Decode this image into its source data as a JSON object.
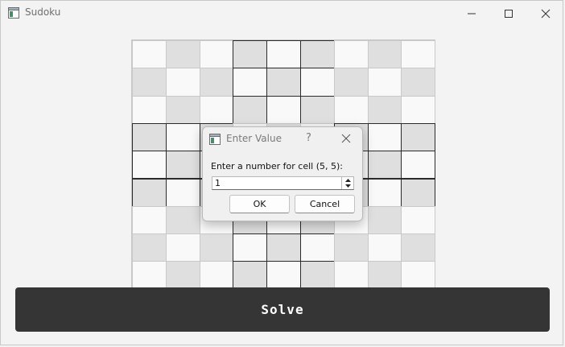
{
  "window": {
    "title": "Sudoku",
    "icon": "app-window-icon",
    "controls": [
      "minimize-icon",
      "maximize-icon",
      "close-icon"
    ]
  },
  "colors": {
    "window_bg": "#f3f3f3",
    "cell_light": "#f9f9f9",
    "cell_dark": "#dfdfdf",
    "cell_border": "#c9c9c9",
    "box_border": "#2b2b2b",
    "solve_bg": "#353535",
    "solve_text": "#ffffff"
  },
  "board": {
    "rows": 9,
    "cols": 9,
    "visible_rows": 9,
    "values": [
      [
        "",
        "",
        "",
        "",
        "",
        "",
        "",
        "",
        ""
      ],
      [
        "",
        "",
        "",
        "",
        "",
        "",
        "",
        "",
        ""
      ],
      [
        "",
        "",
        "",
        "",
        "",
        "",
        "",
        "",
        ""
      ],
      [
        "",
        "",
        "",
        "",
        "",
        "",
        "",
        "",
        ""
      ],
      [
        "",
        "",
        "",
        "",
        "",
        "",
        "",
        "",
        ""
      ],
      [
        "",
        "",
        "",
        "",
        "",
        "",
        "",
        "",
        ""
      ],
      [
        "",
        "",
        "",
        "",
        "",
        "",
        "",
        "",
        ""
      ],
      [
        "",
        "",
        "",
        "",
        "",
        "",
        "",
        "",
        ""
      ],
      [
        "",
        "",
        "",
        "",
        "",
        "",
        "",
        "",
        ""
      ]
    ]
  },
  "solve_button": {
    "label": "Solve"
  },
  "dialog": {
    "title": "Enter Value",
    "help": "?",
    "prompt": "Enter a number for cell (5, 5):",
    "value": "1",
    "ok_label": "OK",
    "cancel_label": "Cancel"
  }
}
